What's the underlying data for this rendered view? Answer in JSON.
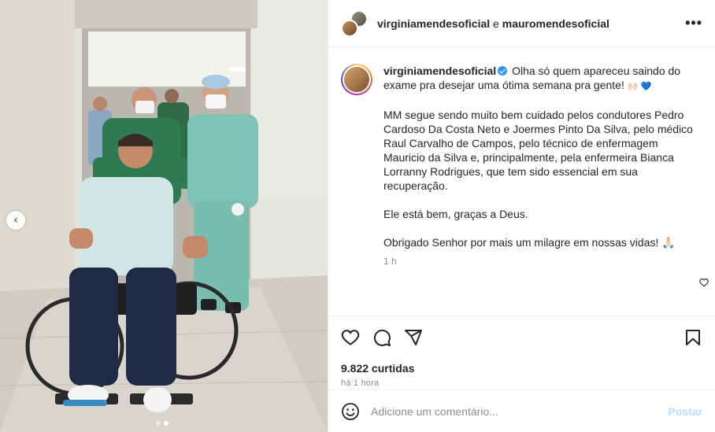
{
  "post": {
    "header": {
      "user1": "virginiamendesoficial",
      "joiner": " e ",
      "user2": "mauromendesoficial",
      "more_icon": "more-horizontal-icon"
    },
    "caption": {
      "username": "virginiamendesoficial",
      "verified": true,
      "line1": "Olha só quem apareceu saindo do exame pra desejar uma ótima semana pra gente!",
      "line1_emojis": "🙌🏻 💙",
      "paragraph2": "MM segue sendo muito bem cuidado pelos condutores Pedro Cardoso Da Costa Neto e Joermes Pinto Da Silva, pelo médico Raul Carvalho de Campos, pelo técnico de enfermagem Mauricio da Silva e, principalmente, pela enfermeira Bianca Lorranny Rodrigues, que tem sido essencial em sua recuperação.",
      "paragraph3": "Ele está bem, graças a Deus.",
      "paragraph4": "Obrigado Senhor por mais um milagre em nossas vidas!",
      "paragraph4_emoji": "🙏🏻",
      "time": "1 h"
    },
    "likes": "9.822 curtidas",
    "posted_ago": "há 1 hora",
    "comment_box": {
      "placeholder": "Adicione um comentário...",
      "post_label": "Postar"
    },
    "carousel": {
      "current_index": 2,
      "total": 2
    }
  },
  "icons": {
    "like": "heart-icon",
    "comment": "comment-icon",
    "share": "share-icon",
    "save": "bookmark-icon",
    "emoji": "emoji-icon",
    "prev": "chevron-left-icon"
  },
  "colors": {
    "verified": "#3897f0",
    "post_button": "#b2dffc",
    "muted_text": "#8e8e8e",
    "scrubs": "#7fc3b4"
  }
}
